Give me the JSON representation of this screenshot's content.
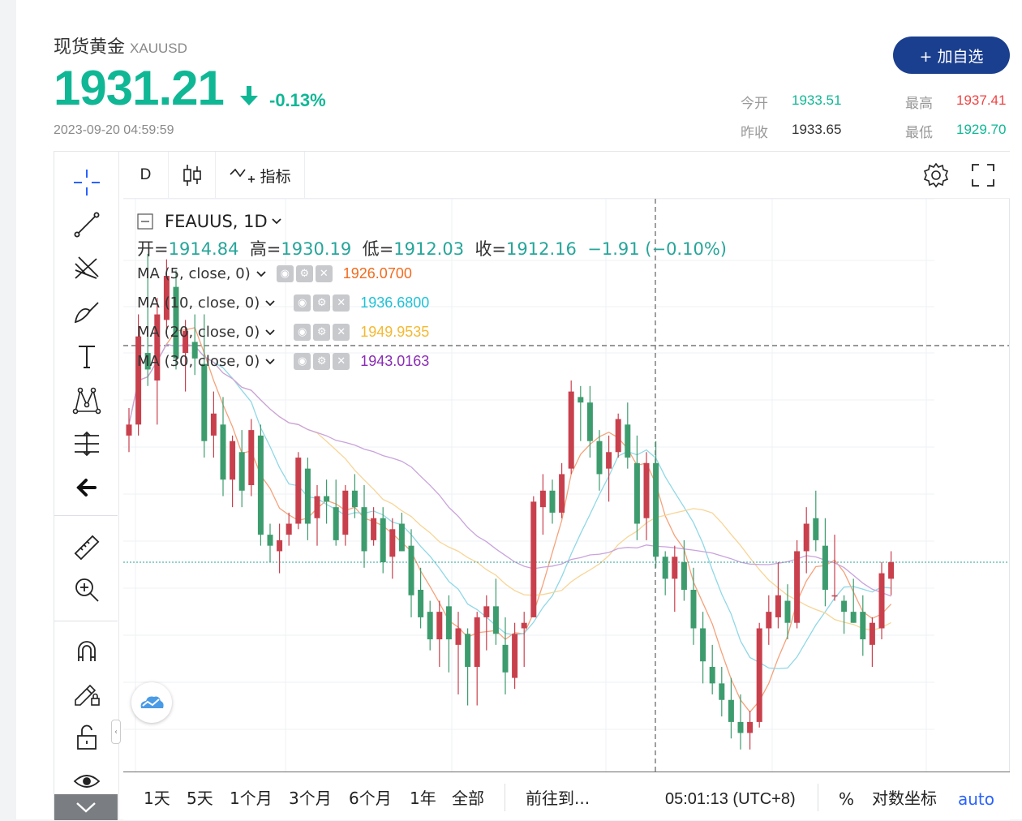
{
  "quote": {
    "name": "现货黄金",
    "code": "XAUUSD",
    "price": "1931.21",
    "change_pct": "-0.13%",
    "timestamp": "2023-09-20 04:59:59",
    "add_button": "+ 加自选",
    "stats": {
      "open_label": "今开",
      "open_value": "1933.51",
      "high_label": "最高",
      "high_value": "1937.41",
      "prev_close_label": "昨收",
      "prev_close_value": "1933.65",
      "low_label": "最低",
      "low_value": "1929.70"
    },
    "colors": {
      "up": "#ef5350",
      "down": "#26a69a",
      "accent": "#10b795"
    }
  },
  "toolbar": {
    "interval": "D",
    "indicators_label": "指标"
  },
  "legend": {
    "symbol": "FEAUUS, 1D",
    "open_label": "开=",
    "open": "1914.84",
    "high_label": "高=",
    "high": "1930.19",
    "low_label": "低=",
    "low": "1912.03",
    "close_label": "收=",
    "close": "1912.16",
    "change": "−1.91 (−0.10%)",
    "indicators": [
      {
        "label": "MA (5, close, 0)",
        "value": "1926.0700",
        "color": "#f26b1d"
      },
      {
        "label": "MA (10, close, 0)",
        "value": "1936.6800",
        "color": "#1ec2d8"
      },
      {
        "label": "MA (20, close, 0)",
        "value": "1949.9535",
        "color": "#f5b932"
      },
      {
        "label": "MA (30, close, 0)",
        "value": "1943.0163",
        "color": "#8a2cb5"
      }
    ]
  },
  "bottom_bar": {
    "ranges": [
      "1天",
      "5天",
      "1个月",
      "3个月",
      "6个月",
      "1年",
      "全部"
    ],
    "goto": "前往到...",
    "clock": "05:01:13 (UTC+8)",
    "percent": "%",
    "log_scale": "对数坐标",
    "auto": "auto"
  },
  "chart_data": {
    "type": "candlestick",
    "symbol": "FEAUUS",
    "interval": "1D",
    "ohlc": [
      [
        1935,
        1940,
        1932,
        1937
      ],
      [
        1937,
        1957,
        1935,
        1953
      ],
      [
        1950,
        1968,
        1944,
        1947
      ],
      [
        1945,
        1960,
        1937,
        1957
      ],
      [
        1956,
        1967,
        1953,
        1964
      ],
      [
        1962,
        1965,
        1947,
        1949
      ],
      [
        1950,
        1956,
        1943,
        1954
      ],
      [
        1952,
        1957,
        1946,
        1949
      ],
      [
        1948,
        1957,
        1931,
        1934
      ],
      [
        1935,
        1943,
        1931,
        1939
      ],
      [
        1937,
        1942,
        1924,
        1927
      ],
      [
        1927,
        1935,
        1922,
        1934
      ],
      [
        1932,
        1936,
        1922,
        1925
      ],
      [
        1926,
        1938,
        1924,
        1936
      ],
      [
        1935,
        1937,
        1915,
        1917
      ],
      [
        1917,
        1919,
        1912,
        1915
      ],
      [
        1914,
        1919,
        1910,
        1916
      ],
      [
        1917,
        1921,
        1915,
        1919
      ],
      [
        1919,
        1932,
        1918,
        1931
      ],
      [
        1929,
        1931,
        1916,
        1919
      ],
      [
        1920,
        1926,
        1915,
        1924
      ],
      [
        1924,
        1927,
        1919,
        1923
      ],
      [
        1922,
        1927,
        1915,
        1916
      ],
      [
        1917,
        1926,
        1915,
        1925
      ],
      [
        1925,
        1928,
        1920,
        1922
      ],
      [
        1922,
        1926,
        1911,
        1914
      ],
      [
        1916,
        1922,
        1915,
        1920
      ],
      [
        1920,
        1922,
        1910,
        1912
      ],
      [
        1913,
        1920,
        1909,
        1918
      ],
      [
        1919,
        1921,
        1914,
        1914
      ],
      [
        1915,
        1918,
        1902,
        1906
      ],
      [
        1907,
        1911,
        1900,
        1902
      ],
      [
        1903,
        1905,
        1896,
        1898
      ],
      [
        1898,
        1905,
        1893,
        1903
      ],
      [
        1904,
        1906,
        1892,
        1898
      ],
      [
        1897,
        1903,
        1888,
        1900
      ],
      [
        1899,
        1900,
        1886,
        1893
      ],
      [
        1893,
        1903,
        1886,
        1902
      ],
      [
        1902,
        1906,
        1896,
        1904
      ],
      [
        1904,
        1909,
        1897,
        1899
      ],
      [
        1897,
        1902,
        1888,
        1892
      ],
      [
        1891,
        1901,
        1889,
        1899
      ],
      [
        1900,
        1903,
        1893,
        1901
      ],
      [
        1902,
        1924,
        1902,
        1923
      ],
      [
        1922,
        1928,
        1917,
        1925
      ],
      [
        1925,
        1927,
        1919,
        1921
      ],
      [
        1921,
        1930,
        1920,
        1928
      ],
      [
        1929,
        1945,
        1928,
        1943
      ],
      [
        1942,
        1944,
        1934,
        1941
      ],
      [
        1941,
        1944,
        1931,
        1934
      ],
      [
        1934,
        1936,
        1925,
        1928
      ],
      [
        1929,
        1935,
        1923,
        1932
      ],
      [
        1932,
        1939,
        1931,
        1938
      ],
      [
        1937,
        1941,
        1929,
        1931
      ],
      [
        1930,
        1935,
        1916,
        1919
      ],
      [
        1920,
        1932,
        1916,
        1930
      ],
      [
        1930,
        1934,
        1911,
        1913
      ],
      [
        1913,
        1914,
        1906,
        1909
      ],
      [
        1909,
        1915,
        1903,
        1913
      ],
      [
        1912,
        1916,
        1905,
        1907
      ],
      [
        1907,
        1911,
        1897,
        1900
      ],
      [
        1900,
        1903,
        1890,
        1894
      ],
      [
        1893,
        1897,
        1888,
        1890
      ],
      [
        1890,
        1893,
        1884,
        1887
      ],
      [
        1887,
        1891,
        1880,
        1883
      ],
      [
        1883,
        1888,
        1878,
        1881
      ],
      [
        1881,
        1885,
        1878,
        1883
      ],
      [
        1883,
        1901,
        1882,
        1900
      ],
      [
        1900,
        1906,
        1897,
        1903
      ],
      [
        1902,
        1912,
        1900,
        1906
      ],
      [
        1905,
        1908,
        1898,
        1901
      ],
      [
        1901,
        1916,
        1900,
        1914
      ],
      [
        1914,
        1922,
        1910,
        1919
      ],
      [
        1920,
        1925,
        1914,
        1916
      ],
      [
        1915,
        1920,
        1904,
        1907
      ],
      [
        1906,
        1917,
        1905,
        1906
      ],
      [
        1905,
        1906,
        1899,
        1903
      ],
      [
        1903,
        1909,
        1901,
        1901
      ],
      [
        1903,
        1906,
        1895,
        1898
      ],
      [
        1897,
        1902,
        1893,
        1901
      ],
      [
        1900,
        1912,
        1898,
        1910
      ],
      [
        1909,
        1914,
        1906,
        1912
      ]
    ],
    "ma": [
      {
        "name": "MA (5, close, 0)",
        "period": 5,
        "color": "#f5a27a"
      },
      {
        "name": "MA (10, close, 0)",
        "period": 10,
        "color": "#8fd8e6"
      },
      {
        "name": "MA (20, close, 0)",
        "period": 20,
        "color": "#f7d596"
      },
      {
        "name": "MA (30, close, 0)",
        "period": 30,
        "color": "#c9a3dc"
      }
    ],
    "ylim": [
      1874,
      1978
    ],
    "grid": true
  }
}
